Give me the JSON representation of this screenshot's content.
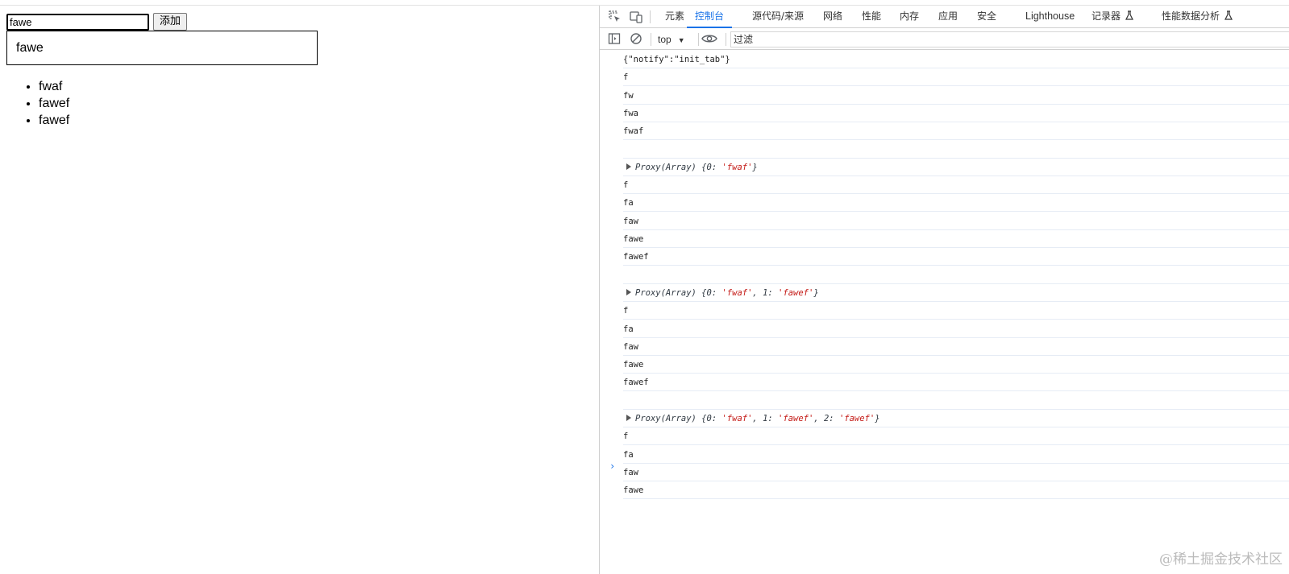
{
  "page": {
    "input_value": "fawe",
    "add_button_label": "添加",
    "preview_text": "fawe",
    "todos": [
      "fwaf",
      "fawef",
      "fawef"
    ]
  },
  "devtools": {
    "tabs": [
      "元素",
      "控制台",
      "源代码/来源",
      "网络",
      "性能",
      "内存",
      "应用",
      "安全",
      "Lighthouse",
      "记录器",
      "性能数据分析"
    ],
    "active_tab": "控制台",
    "context": "top",
    "filter_placeholder": "过滤",
    "console_lines": [
      "{\"notify\":\"init_tab\"}",
      "f",
      "fw",
      "fwa",
      "fwaf",
      "",
      "Proxy(Array) {0: 'fwaf'}",
      "f",
      "fa",
      "faw",
      "fawe",
      "fawef",
      "",
      "Proxy(Array) {0: 'fwaf', 1: 'fawef'}",
      "f",
      "fa",
      "faw",
      "fawe",
      "fawef",
      "",
      "Proxy(Array) {0: 'fwaf', 1: 'fawef', 2: 'fawef'}",
      "f",
      "fa",
      "faw",
      "fawe"
    ],
    "proxy_entries": [
      [
        "fwaf"
      ],
      [
        "fwaf",
        "fawef"
      ],
      [
        "fwaf",
        "fawef",
        "fawef"
      ]
    ],
    "colors": {
      "accent": "#1a73e8",
      "string": "#c41a16"
    }
  },
  "watermark": "@稀土掘金技术社区"
}
